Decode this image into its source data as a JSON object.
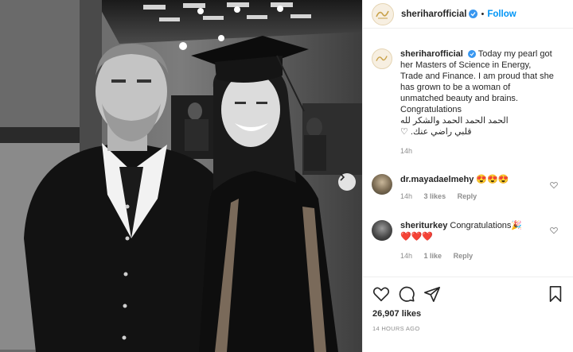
{
  "post": {
    "username": "sheriharofficial",
    "dot": "•",
    "follow_label": "Follow"
  },
  "caption": {
    "username": "sheriharofficial",
    "text": "Today my pearl got her Masters of Science in Energy, Trade and Finance. I am proud that she has grown to be a woman of unmatched beauty and brains.",
    "line2": "Congratulations",
    "line3": "الحمد الحمد الحمد والشكر لله",
    "line4": "قلبي راضي عنك. ♡",
    "time": "14h"
  },
  "comments": [
    {
      "username": "dr.mayadaelmehy",
      "text": "😍😍😍",
      "time": "14h",
      "likes": "3 likes",
      "reply": "Reply"
    },
    {
      "username": "sheriturkey",
      "text": "Congratulations🎉",
      "text2": "❤️❤️❤️",
      "time": "14h",
      "likes": "1 like",
      "reply": "Reply"
    }
  ],
  "footer": {
    "likes": "26,907 likes",
    "time_ago": "14 HOURS AGO"
  },
  "icons": {
    "like": "heart-icon",
    "comment": "comment-icon",
    "share": "share-icon",
    "save": "bookmark-icon",
    "verified": "verified-badge-icon",
    "next": "chevron-right-icon"
  },
  "colors": {
    "accent": "#0095f6",
    "verified": "#3897f0",
    "muted": "#8e8e8e"
  }
}
